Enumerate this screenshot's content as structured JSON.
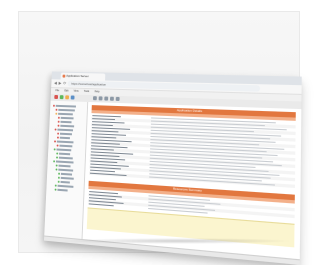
{
  "browser": {
    "tab_title": "Application Server",
    "url": "https://somehost/application",
    "nav_back": "◀",
    "nav_forward": "▶",
    "nav_reload": "⟳"
  },
  "menus": [
    "File",
    "Edit",
    "View",
    "Tools",
    "Help"
  ],
  "panels": {
    "top_header": "Application Details",
    "bottom_header": "Resources Summary"
  },
  "colors": {
    "accent": "#e2773f",
    "accent_light": "#f3b08a",
    "note_bg": "#fbf5cf"
  },
  "icons": [
    "back-icon",
    "forward-icon",
    "reload-icon",
    "folder-icon",
    "app-logo"
  ]
}
